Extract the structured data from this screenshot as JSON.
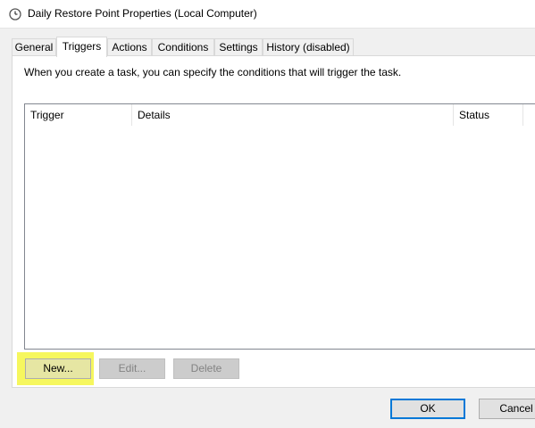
{
  "window": {
    "title": "Daily Restore Point Properties (Local Computer)",
    "icon": "clock-icon"
  },
  "tabs": [
    {
      "label": "General"
    },
    {
      "label": "Triggers"
    },
    {
      "label": "Actions"
    },
    {
      "label": "Conditions"
    },
    {
      "label": "Settings"
    },
    {
      "label": "History (disabled)"
    }
  ],
  "active_tab": "Triggers",
  "triggers_panel": {
    "description": "When you create a task, you can specify the conditions that will trigger the task.",
    "columns": [
      {
        "label": "Trigger"
      },
      {
        "label": "Details"
      },
      {
        "label": "Status"
      }
    ],
    "rows": [],
    "buttons": {
      "new": "New...",
      "edit": "Edit...",
      "delete": "Delete"
    }
  },
  "footer": {
    "ok": "OK",
    "cancel": "Cancel"
  },
  "colors": {
    "highlight": "#f6f75e",
    "ok_border": "#0078d7"
  }
}
